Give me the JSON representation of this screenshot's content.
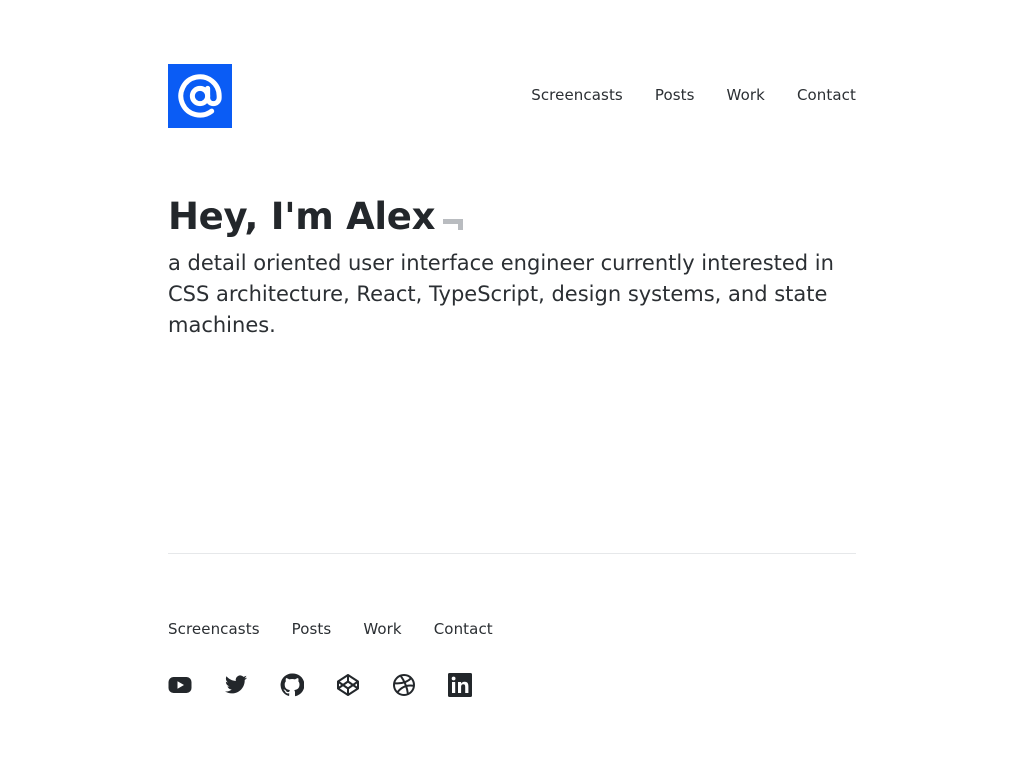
{
  "logo": {
    "glyph": "@",
    "icon": "at-sign-logo",
    "color": "#0a5cf5"
  },
  "header_nav": [
    {
      "label": "Screencasts"
    },
    {
      "label": "Posts"
    },
    {
      "label": "Work"
    },
    {
      "label": "Contact"
    }
  ],
  "hero": {
    "title": "Hey, I'm Alex",
    "subtitle": "a detail oriented user interface engineer currently interested in CSS architecture, React, TypeScript, design systems, and state machines."
  },
  "footer_nav": [
    {
      "label": "Screencasts"
    },
    {
      "label": "Posts"
    },
    {
      "label": "Work"
    },
    {
      "label": "Contact"
    }
  ],
  "social_icons": [
    "youtube-icon",
    "twitter-icon",
    "github-icon",
    "codepen-icon",
    "dribbble-icon",
    "linkedin-icon"
  ]
}
